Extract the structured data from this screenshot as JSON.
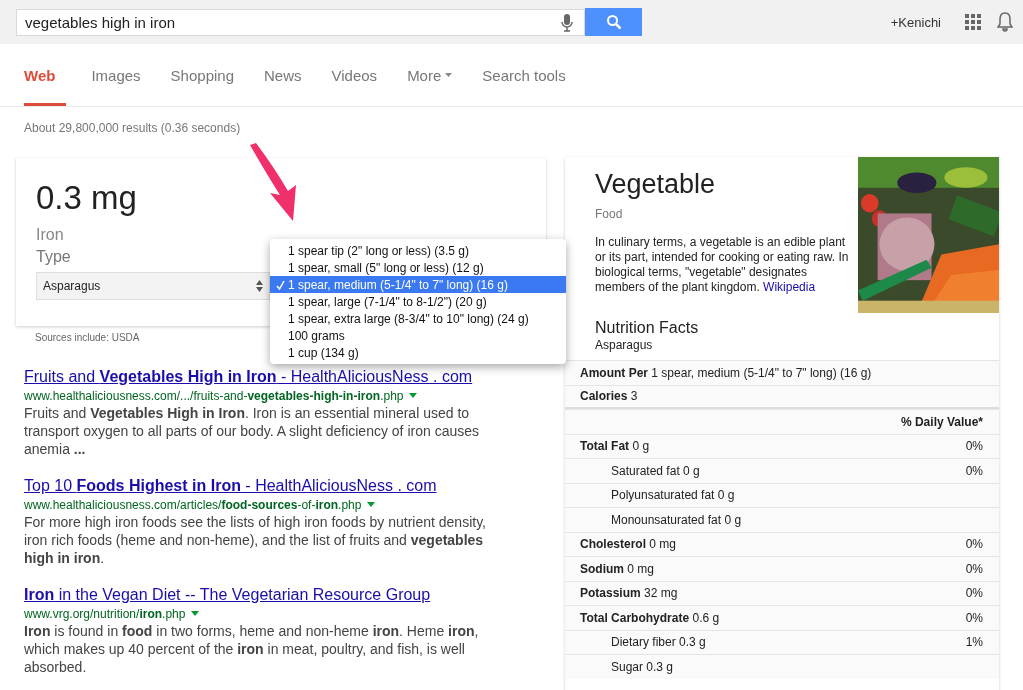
{
  "search": {
    "value": "vegetables high in iron"
  },
  "account": {
    "name": "+Kenichi"
  },
  "tabs": [
    {
      "label": "Web",
      "selected": true,
      "kind": "tab"
    },
    {
      "label": "Images",
      "selected": false,
      "kind": "tab"
    },
    {
      "label": "Shopping",
      "selected": false,
      "kind": "tab"
    },
    {
      "label": "News",
      "selected": false,
      "kind": "tab"
    },
    {
      "label": "Videos",
      "selected": false,
      "kind": "tab"
    },
    {
      "label": "More",
      "selected": false,
      "kind": "menu"
    },
    {
      "label": "Search tools",
      "selected": false,
      "kind": "tab"
    }
  ],
  "result_stats": "About 29,800,000 results (0.36 seconds)",
  "answer": {
    "value": "0.3 mg",
    "nutrient": "Iron",
    "type_label": "Type",
    "type_select": "Asparagus",
    "sources": "Sources include: USDA",
    "serving_options": [
      {
        "label": "1 spear tip (2\" long or less) (3.5 g)",
        "selected": false
      },
      {
        "label": "1 spear, small (5\" long or less) (12 g)",
        "selected": false
      },
      {
        "label": "1 spear, medium (5-1/4\" to 7\" long) (16 g)",
        "selected": true
      },
      {
        "label": "1 spear, large (7-1/4\" to 8-1/2\") (20 g)",
        "selected": false
      },
      {
        "label": "1 spear, extra large (8-3/4\" to 10\" long) (24 g)",
        "selected": false
      },
      {
        "label": "100 grams",
        "selected": false
      },
      {
        "label": "1 cup (134 g)",
        "selected": false
      }
    ]
  },
  "results": [
    {
      "title": "Fruits and **Vegetables High in Iron** - HealthAliciousNess . com",
      "url": "www.healthaliciousness.com/.../fruits-and-**vegetables-high-in-iron**.php",
      "snippet": "Fruits and **Vegetables High in Iron**. Iron is an essential mineral used to transport oxygen to all parts of our body. A slight deficiency of iron causes anemia **...**"
    },
    {
      "title": "Top 10 **Foods Highest in Iron** - HealthAliciousNess . com",
      "url": "www.healthaliciousness.com/articles/**food-sources**-of-**iron**.php",
      "snippet": "For more high iron foods see the lists of high iron foods by nutrient density, iron rich foods (heme and non-heme), and the list of fruits and **vegetables high in iron**."
    },
    {
      "title": "**Iron** in the Vegan Diet -- The Vegetarian Resource Group",
      "url": "www.vrg.org/nutrition/**iron**.php",
      "snippet": "**Iron** is found in **food** in two forms, heme and non-heme **iron**. Heme **iron**, which makes up 40 percent of the **iron** in meat, poultry, and fish, is well absorbed."
    }
  ],
  "knowledge_panel": {
    "title": "Vegetable",
    "subtitle": "Food",
    "description": "In culinary terms, a vegetable is an edible plant or its part, intended for cooking or eating raw. In biological terms, \"vegetable\" designates members of the plant kingdom.",
    "source_link": "Wikipedia",
    "nutrition": {
      "title": "Nutrition Facts",
      "food": "Asparagus",
      "amount_per": "**Amount Per** 1 spear, medium (5-1/4\" to 7\" long) (16 g)",
      "calories": "**Calories** 3",
      "dv_header": "% Daily Value*",
      "rows": [
        {
          "label": "Total Fat",
          "amount": "0 g",
          "dv": "0%",
          "children": [
            {
              "label": "Saturated fat",
              "amount": "0 g",
              "dv": "0%"
            },
            {
              "label": "Polyunsaturated fat",
              "amount": "0 g"
            },
            {
              "label": "Monounsaturated fat",
              "amount": "0 g"
            }
          ]
        },
        {
          "label": "Cholesterol",
          "amount": "0 mg",
          "dv": "0%"
        },
        {
          "label": "Sodium",
          "amount": "0 mg",
          "dv": "0%"
        },
        {
          "label": "Potassium",
          "amount": "32 mg",
          "dv": "0%"
        },
        {
          "label": "Total Carbohydrate",
          "amount": "0.6 g",
          "dv": "0%",
          "children": [
            {
              "label": "Dietary fiber",
              "amount": "0.3 g",
              "dv": "1%"
            },
            {
              "label": "Sugar",
              "amount": "0.3 g"
            }
          ]
        }
      ]
    }
  }
}
